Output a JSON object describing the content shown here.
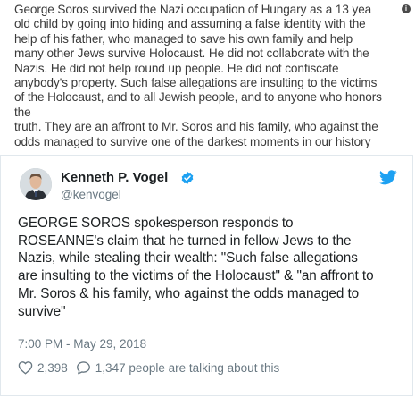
{
  "quote_image": {
    "text": "George Soros survived the Nazi occupation of Hungary as a 13 yea\nold child by going into hiding and assuming a false identity with the\nhelp of his father, who managed to save his own family and help\nmany other Jews survive Holocaust.  He did not collaborate with the\nNazis. He did not help round up people. He did not confiscate\nanybody's property. Such false allegations are insulting to the victims\nof the Holocaust, and to all Jewish people, and to anyone who honors the\ntruth. They are an affront to Mr. Soros and his family, who against the\nodds managed to survive one of the darkest moments in our history",
    "info_icon": "info-icon"
  },
  "tweet": {
    "author": {
      "name": "Kenneth P. Vogel",
      "handle": "@kenvogel",
      "verified_icon": "verified-badge-icon",
      "avatar_icon": "avatar"
    },
    "brand_icon": "twitter-bird-icon",
    "text": "GEORGE SOROS spokesperson responds to\nROSEANNE's claim that he turned in fellow Jews to the\nNazis, while stealing their wealth: \"Such false allegations\nare insulting to the victims of the Holocaust\" & \"an affront to\nMr. Soros & his family, who against the odds managed to\nsurvive\"",
    "timestamp": "7:00 PM - May 29, 2018",
    "likes": "2,398",
    "talking": "1,347 people are talking about this"
  },
  "colors": {
    "twitter_blue": "#1da1f2",
    "text_primary": "#1c2022",
    "text_secondary": "#697882",
    "border": "#e1e8ed"
  }
}
